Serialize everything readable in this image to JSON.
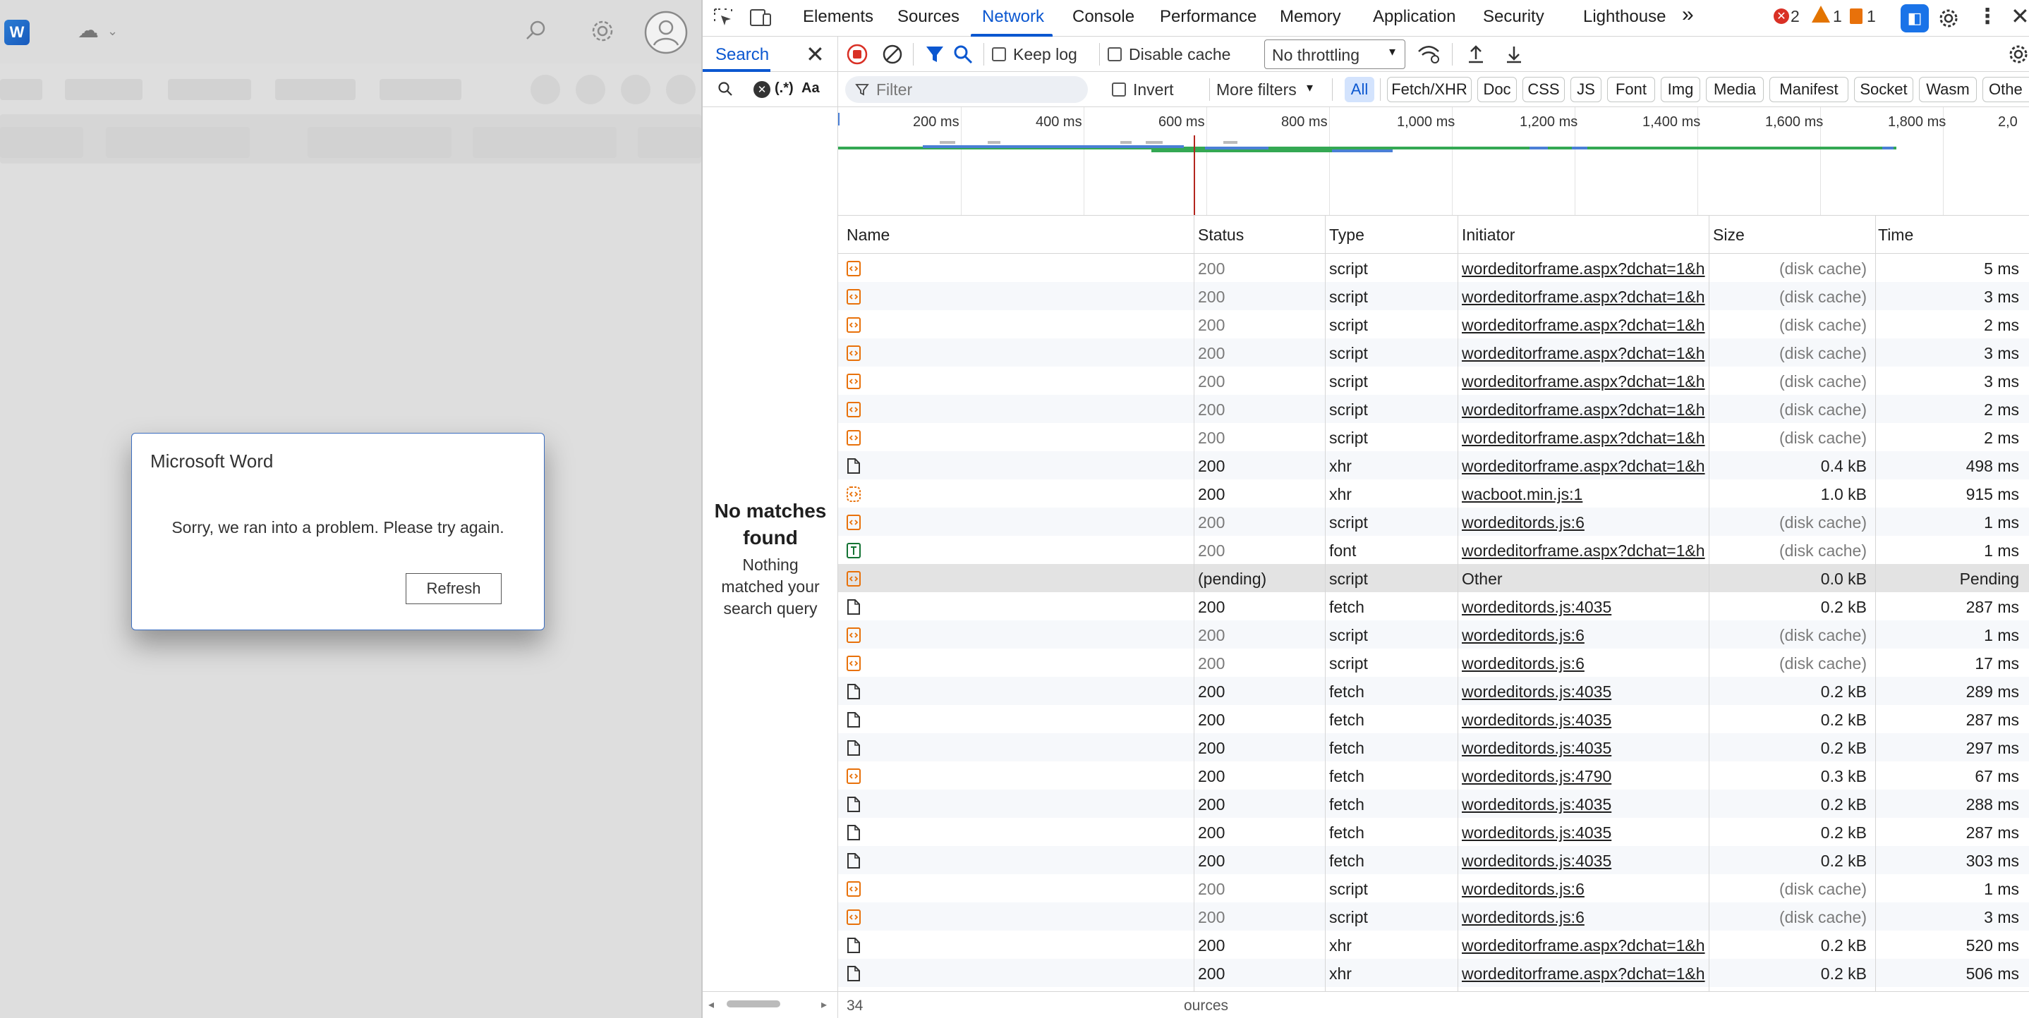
{
  "dialog": {
    "title": "Microsoft Word",
    "message": "Sorry, we ran into a problem. Please try again.",
    "refresh_label": "Refresh"
  },
  "app": {
    "logo_letter": "W"
  },
  "devtools": {
    "tabs": [
      "Elements",
      "Sources",
      "Network",
      "Console",
      "Performance",
      "Memory",
      "Application",
      "Security",
      "Lighthouse"
    ],
    "active_tab": "Network",
    "more_tabs": "»",
    "errors": "2",
    "warnings": "1",
    "issues": "1",
    "search": {
      "title": "Search",
      "regex_label": "(.*)",
      "case_label": "Aa",
      "no_matches_title": "No matches found",
      "no_matches_sub": "Nothing matched your search query"
    },
    "toolbar": {
      "keep_log": "Keep log",
      "disable_cache": "Disable cache",
      "throttling": "No throttling"
    },
    "filter": {
      "placeholder": "Filter",
      "invert": "Invert",
      "more_filters": "More filters",
      "chips": [
        "All",
        "Fetch/XHR",
        "Doc",
        "CSS",
        "JS",
        "Font",
        "Img",
        "Media",
        "Manifest",
        "Socket",
        "Wasm",
        "Othe"
      ]
    },
    "timeline": {
      "ticks": [
        "200 ms",
        "400 ms",
        "600 ms",
        "800 ms",
        "1,000 ms",
        "1,200 ms",
        "1,400 ms",
        "1,600 ms",
        "1,800 ms",
        "2,0"
      ]
    },
    "columns": [
      "Name",
      "Status",
      "Type",
      "Initiator",
      "Size",
      "Time"
    ],
    "rows": [
      {
        "icon": "script",
        "status": "200",
        "type": "script",
        "initiator": "wordeditorframe.aspx?dchat=1&h",
        "size": "(disk cache)",
        "time": "5 ms",
        "cached": true
      },
      {
        "icon": "script",
        "status": "200",
        "type": "script",
        "initiator": "wordeditorframe.aspx?dchat=1&h",
        "size": "(disk cache)",
        "time": "3 ms",
        "cached": true
      },
      {
        "icon": "script",
        "status": "200",
        "type": "script",
        "initiator": "wordeditorframe.aspx?dchat=1&h",
        "size": "(disk cache)",
        "time": "2 ms",
        "cached": true
      },
      {
        "icon": "script",
        "status": "200",
        "type": "script",
        "initiator": "wordeditorframe.aspx?dchat=1&h",
        "size": "(disk cache)",
        "time": "3 ms",
        "cached": true
      },
      {
        "icon": "script",
        "status": "200",
        "type": "script",
        "initiator": "wordeditorframe.aspx?dchat=1&h",
        "size": "(disk cache)",
        "time": "3 ms",
        "cached": true
      },
      {
        "icon": "script",
        "status": "200",
        "type": "script",
        "initiator": "wordeditorframe.aspx?dchat=1&h",
        "size": "(disk cache)",
        "time": "2 ms",
        "cached": true
      },
      {
        "icon": "script",
        "status": "200",
        "type": "script",
        "initiator": "wordeditorframe.aspx?dchat=1&h",
        "size": "(disk cache)",
        "time": "2 ms",
        "cached": true
      },
      {
        "icon": "doc",
        "status": "200",
        "type": "xhr",
        "initiator": "wordeditorframe.aspx?dchat=1&h",
        "size": "0.4 kB",
        "time": "498 ms",
        "cached": false
      },
      {
        "icon": "xhrscript",
        "status": "200",
        "type": "xhr",
        "initiator": "wacboot.min.js:1",
        "size": "1.0 kB",
        "time": "915 ms",
        "cached": false
      },
      {
        "icon": "script",
        "status": "200",
        "type": "script",
        "initiator": "wordeditords.js:6",
        "size": "(disk cache)",
        "time": "1 ms",
        "cached": true
      },
      {
        "icon": "font",
        "status": "200",
        "type": "font",
        "initiator": "wordeditorframe.aspx?dchat=1&h",
        "size": "(disk cache)",
        "time": "1 ms",
        "cached": true
      },
      {
        "icon": "script",
        "status": "(pending)",
        "type": "script",
        "initiator": "Other",
        "size": "0.0 kB",
        "time": "Pending",
        "cached": false,
        "pending": true
      },
      {
        "icon": "doc",
        "status": "200",
        "type": "fetch",
        "initiator": "wordeditords.js:4035",
        "size": "0.2 kB",
        "time": "287 ms",
        "cached": false
      },
      {
        "icon": "script",
        "status": "200",
        "type": "script",
        "initiator": "wordeditords.js:6",
        "size": "(disk cache)",
        "time": "1 ms",
        "cached": true
      },
      {
        "icon": "script",
        "status": "200",
        "type": "script",
        "initiator": "wordeditords.js:6",
        "size": "(disk cache)",
        "time": "17 ms",
        "cached": true
      },
      {
        "icon": "doc",
        "status": "200",
        "type": "fetch",
        "initiator": "wordeditords.js:4035",
        "size": "0.2 kB",
        "time": "289 ms",
        "cached": false
      },
      {
        "icon": "doc",
        "status": "200",
        "type": "fetch",
        "initiator": "wordeditords.js:4035",
        "size": "0.2 kB",
        "time": "287 ms",
        "cached": false
      },
      {
        "icon": "doc",
        "status": "200",
        "type": "fetch",
        "initiator": "wordeditords.js:4035",
        "size": "0.2 kB",
        "time": "297 ms",
        "cached": false
      },
      {
        "icon": "script",
        "status": "200",
        "type": "fetch",
        "initiator": "wordeditords.js:4790",
        "size": "0.3 kB",
        "time": "67 ms",
        "cached": false
      },
      {
        "icon": "doc",
        "status": "200",
        "type": "fetch",
        "initiator": "wordeditords.js:4035",
        "size": "0.2 kB",
        "time": "288 ms",
        "cached": false
      },
      {
        "icon": "doc",
        "status": "200",
        "type": "fetch",
        "initiator": "wordeditords.js:4035",
        "size": "0.2 kB",
        "time": "287 ms",
        "cached": false
      },
      {
        "icon": "doc",
        "status": "200",
        "type": "fetch",
        "initiator": "wordeditords.js:4035",
        "size": "0.2 kB",
        "time": "303 ms",
        "cached": false
      },
      {
        "icon": "script",
        "status": "200",
        "type": "script",
        "initiator": "wordeditords.js:6",
        "size": "(disk cache)",
        "time": "1 ms",
        "cached": true
      },
      {
        "icon": "script",
        "status": "200",
        "type": "script",
        "initiator": "wordeditords.js:6",
        "size": "(disk cache)",
        "time": "3 ms",
        "cached": true
      },
      {
        "icon": "doc",
        "status": "200",
        "type": "xhr",
        "initiator": "wordeditorframe.aspx?dchat=1&h",
        "size": "0.2 kB",
        "time": "520 ms",
        "cached": false
      },
      {
        "icon": "doc",
        "status": "200",
        "type": "xhr",
        "initiator": "wordeditorframe.aspx?dchat=1&h",
        "size": "0.2 kB",
        "time": "506 ms",
        "cached": false
      }
    ],
    "statusbar": {
      "count": "34",
      "resources": "ources"
    },
    "colors": {
      "accent": "#0b57d0",
      "record": "#d93025",
      "script_icon": "#e8710a",
      "font_icon": "#137333",
      "waterfall_green": "#34a853",
      "waterfall_blue": "#4a7fd6",
      "load_line": "#b3261e"
    }
  }
}
